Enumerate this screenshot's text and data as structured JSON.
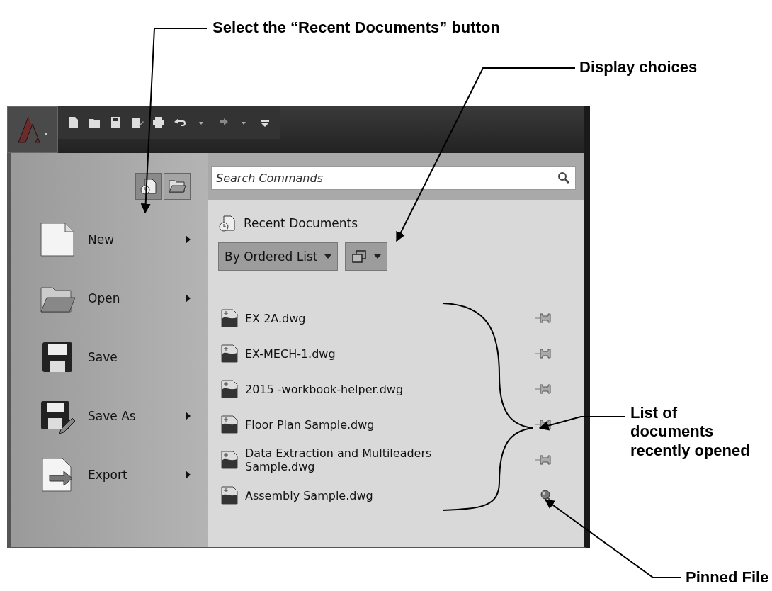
{
  "annotations": [
    {
      "text": "Select the “Recent Documents” button"
    },
    {
      "text": "Display choices"
    },
    {
      "text": "List of documents recently opened"
    },
    {
      "text": "Pinned File"
    }
  ],
  "search": {
    "placeholder": "Search Commands"
  },
  "view_buttons": [
    {
      "kind": "recent",
      "selected": true
    },
    {
      "kind": "open",
      "selected": false
    }
  ],
  "heading": "Recent Documents",
  "sort_dropdown": "By Ordered List",
  "menu": [
    {
      "kind": "new",
      "label": "New",
      "submenu": true
    },
    {
      "kind": "open",
      "label": "Open",
      "submenu": true
    },
    {
      "kind": "save",
      "label": "Save",
      "submenu": false
    },
    {
      "kind": "saveas",
      "label": "Save As",
      "submenu": true
    },
    {
      "kind": "export",
      "label": "Export",
      "submenu": true
    }
  ],
  "documents": [
    {
      "name": "EX 2A.dwg",
      "pinned": false
    },
    {
      "name": "EX-MECH-1.dwg",
      "pinned": false
    },
    {
      "name": "2015 -workbook-helper.dwg",
      "pinned": false
    },
    {
      "name": "Floor Plan Sample.dwg",
      "pinned": false
    },
    {
      "name": "Data Extraction and Multileaders Sample.dwg",
      "pinned": false
    },
    {
      "name": "Assembly Sample.dwg",
      "pinned": true
    }
  ]
}
